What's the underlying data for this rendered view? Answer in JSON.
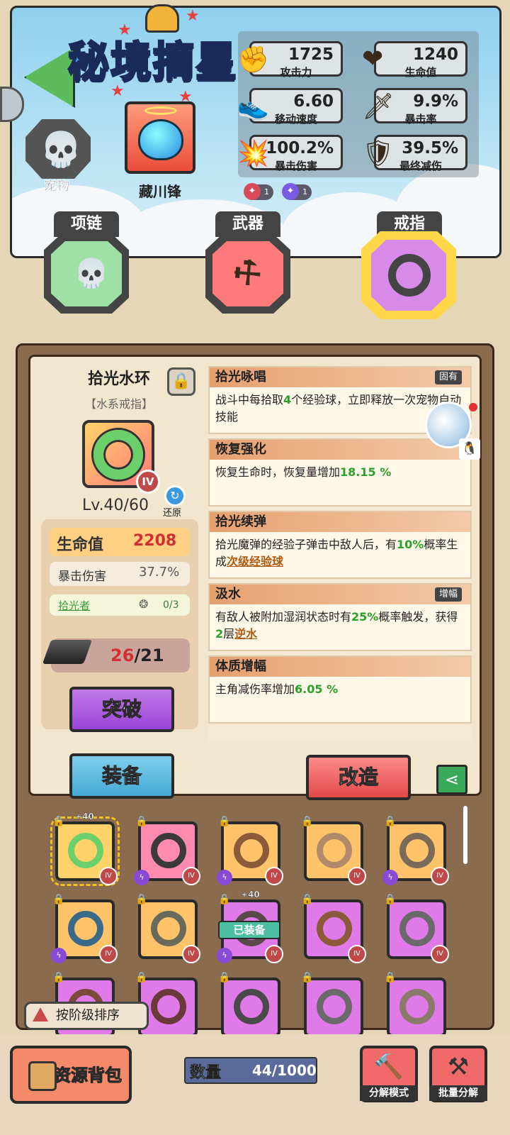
{
  "header": {
    "title": "秘境摘星",
    "pet_label": "宠物",
    "hero_name": "藏川锋"
  },
  "stats": [
    {
      "icon": "fist-icon",
      "value": "1725",
      "label": "攻击力"
    },
    {
      "icon": "heart-icon",
      "value": "1240",
      "label": "生命值"
    },
    {
      "icon": "shoe-icon",
      "value": "6.60",
      "label": "移动速度"
    },
    {
      "icon": "sword-icon",
      "value": "9.9%",
      "label": "暴击率"
    },
    {
      "icon": "explosion-icon",
      "value": "100.2%",
      "label": "暴击伤害"
    },
    {
      "icon": "shield-icon",
      "value": "39.5%",
      "label": "最终减伤"
    }
  ],
  "buffs": [
    {
      "icon": "fire-orb-icon",
      "count": "1"
    },
    {
      "icon": "arcane-orb-icon",
      "count": "1"
    }
  ],
  "slots": {
    "necklace": "项链",
    "weapon": "武器",
    "ring": "戒指"
  },
  "item": {
    "name": "拾光水环",
    "type": "【水系戒指】",
    "tier": "IV",
    "level": "Lv.40/60",
    "restore_label": "还原",
    "hp_label": "生命值",
    "hp_value": "2208",
    "crit_label": "暴击伤害",
    "crit_value": "37.7%",
    "set_name": "拾光者",
    "set_progress": "0/3",
    "material_current": "26",
    "material_required": "/21",
    "breakthrough_label": "突破",
    "equip_label": "装备",
    "reforge_label": "改造"
  },
  "affixes": [
    {
      "title": "拾光咏唱",
      "tag": "固有",
      "segments": [
        [
          "战斗中每拾取",
          ""
        ],
        [
          "4",
          "g"
        ],
        [
          "个经验球，立即释放一次宠物自动技能",
          ""
        ]
      ]
    },
    {
      "title": "恢复强化",
      "tag": "",
      "segments": [
        [
          "恢复生命时，恢复量增加",
          ""
        ],
        [
          "18.15 %",
          "g"
        ]
      ]
    },
    {
      "title": "拾光续弹",
      "tag": "",
      "segments": [
        [
          "拾光魔弹的经验子弹击中敌人后，有",
          ""
        ],
        [
          "10%",
          "g"
        ],
        [
          "概率生成",
          ""
        ],
        [
          "次级经验球",
          "u"
        ]
      ]
    },
    {
      "title": "汲水",
      "tag": "增幅",
      "segments": [
        [
          "有敌人被附加湿润状态时有",
          ""
        ],
        [
          "25%",
          "g"
        ],
        [
          "概率触发，获得",
          ""
        ],
        [
          "2",
          "g"
        ],
        [
          "层",
          ""
        ],
        [
          "逆水",
          "u"
        ]
      ]
    },
    {
      "title": "体质增幅",
      "tag": "",
      "segments": [
        [
          "主角减伤率增加",
          ""
        ],
        [
          "6.05 %",
          "g"
        ]
      ]
    }
  ],
  "inventory": [
    {
      "bg": "#ffd26a",
      "ring": "#6bd06b",
      "tier": "IV",
      "plus": "+40",
      "selected": true,
      "skill": false,
      "equipped": false
    },
    {
      "bg": "#ff8ab0",
      "ring": "#3a3a3a",
      "tier": "IV",
      "plus": "",
      "selected": false,
      "skill": true,
      "equipped": false
    },
    {
      "bg": "#ffc36a",
      "ring": "#8a5a3a",
      "tier": "IV",
      "plus": "",
      "selected": false,
      "skill": true,
      "equipped": false
    },
    {
      "bg": "#ffc36a",
      "ring": "#b08a6a",
      "tier": "IV",
      "plus": "",
      "selected": false,
      "skill": false,
      "equipped": false
    },
    {
      "bg": "#ffc36a",
      "ring": "#7a6a5a",
      "tier": "IV",
      "plus": "",
      "selected": false,
      "skill": true,
      "equipped": false
    },
    {
      "bg": "#ffc36a",
      "ring": "#3a6a8a",
      "tier": "IV",
      "plus": "",
      "selected": false,
      "skill": true,
      "equipped": false
    },
    {
      "bg": "#ffc36a",
      "ring": "#6a6a5a",
      "tier": "IV",
      "plus": "",
      "selected": false,
      "skill": false,
      "equipped": false
    },
    {
      "bg": "#e07ae8",
      "ring": "#5a4a4a",
      "tier": "IV",
      "plus": "+40",
      "selected": false,
      "skill": true,
      "equipped": true
    },
    {
      "bg": "#e07ae8",
      "ring": "#8a5a3a",
      "tier": "IV",
      "plus": "",
      "selected": false,
      "skill": false,
      "equipped": false
    },
    {
      "bg": "#e07ae8",
      "ring": "#6a6a6a",
      "tier": "IV",
      "plus": "",
      "selected": false,
      "skill": false,
      "equipped": false
    },
    {
      "bg": "#e07ae8",
      "ring": "#7a4a3a",
      "tier": "",
      "plus": "",
      "selected": false,
      "skill": false,
      "equipped": false
    },
    {
      "bg": "#e07ae8",
      "ring": "#6a3a3a",
      "tier": "",
      "plus": "",
      "selected": false,
      "skill": false,
      "equipped": false
    },
    {
      "bg": "#e07ae8",
      "ring": "#4a4a4a",
      "tier": "",
      "plus": "",
      "selected": false,
      "skill": false,
      "equipped": false
    },
    {
      "bg": "#e07ae8",
      "ring": "#6a6a6a",
      "tier": "",
      "plus": "",
      "selected": false,
      "skill": false,
      "equipped": false
    },
    {
      "bg": "#e07ae8",
      "ring": "#8a7a6a",
      "tier": "",
      "plus": "",
      "selected": false,
      "skill": false,
      "equipped": false
    }
  ],
  "inventory_labels": {
    "equipped": "已装备",
    "sort": "按阶级排序"
  },
  "bottom": {
    "resource_bag": "资源背包",
    "count_label": "数量",
    "count_value": "44/1000",
    "decompose_mode": "分解模式",
    "batch_decompose": "批量分解"
  }
}
